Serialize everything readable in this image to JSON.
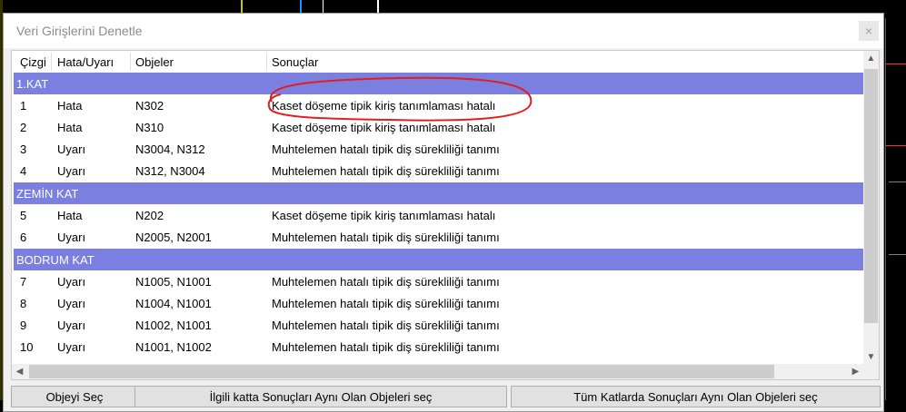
{
  "dialog": {
    "title": "Veri Girişlerini Denetle",
    "close_label": "×"
  },
  "table": {
    "columns": [
      "Çizgi",
      "Hata/Uyarı",
      "Objeler",
      "Sonuçlar"
    ],
    "groups": [
      {
        "label": "1.KAT",
        "rows": [
          {
            "line": "1",
            "type": "Hata",
            "objects": "N302",
            "result": "Kaset döşeme tipik kiriş tanımlaması hatalı"
          },
          {
            "line": "2",
            "type": "Hata",
            "objects": "N310",
            "result": "Kaset döşeme tipik kiriş tanımlaması hatalı"
          },
          {
            "line": "3",
            "type": "Uyarı",
            "objects": "N3004, N312",
            "result": "Muhtelemen hatalı tipik diş sürekliliği tanımı"
          },
          {
            "line": "4",
            "type": "Uyarı",
            "objects": "N312, N3004",
            "result": "Muhtelemen hatalı tipik diş sürekliliği tanımı"
          }
        ]
      },
      {
        "label": "ZEMİN KAT",
        "rows": [
          {
            "line": "5",
            "type": "Hata",
            "objects": "N202",
            "result": "Kaset döşeme tipik kiriş tanımlaması hatalı"
          },
          {
            "line": "6",
            "type": "Uyarı",
            "objects": "N2005, N2001",
            "result": "Muhtelemen hatalı tipik diş sürekliliği tanımı"
          }
        ]
      },
      {
        "label": "BODRUM KAT",
        "rows": [
          {
            "line": "7",
            "type": "Uyarı",
            "objects": "N1005, N1001",
            "result": "Muhtelemen hatalı tipik diş sürekliliği tanımı"
          },
          {
            "line": "8",
            "type": "Uyarı",
            "objects": "N1004, N1001",
            "result": "Muhtelemen hatalı tipik diş sürekliliği tanımı"
          },
          {
            "line": "9",
            "type": "Uyarı",
            "objects": "N1002, N1001",
            "result": "Muhtelemen hatalı tipik diş sürekliliği tanımı"
          },
          {
            "line": "10",
            "type": "Uyarı",
            "objects": "N1001, N1002",
            "result": "Muhtelemen hatalı tipik diş sürekliliği tanımı"
          }
        ]
      }
    ]
  },
  "buttons": {
    "select_object": "Objeyi Seç",
    "select_same_floor": "İlgili katta Sonuçları Aynı Olan Objeleri seç",
    "select_all_floors": "Tüm Katlarda Sonuçları Aynı Olan Objeleri seç"
  },
  "scroll": {
    "up": "▲",
    "down": "▼",
    "left": "◀",
    "right": "▶"
  },
  "colors": {
    "group_header": "#7b7fe0",
    "annotation": "#e02020"
  }
}
